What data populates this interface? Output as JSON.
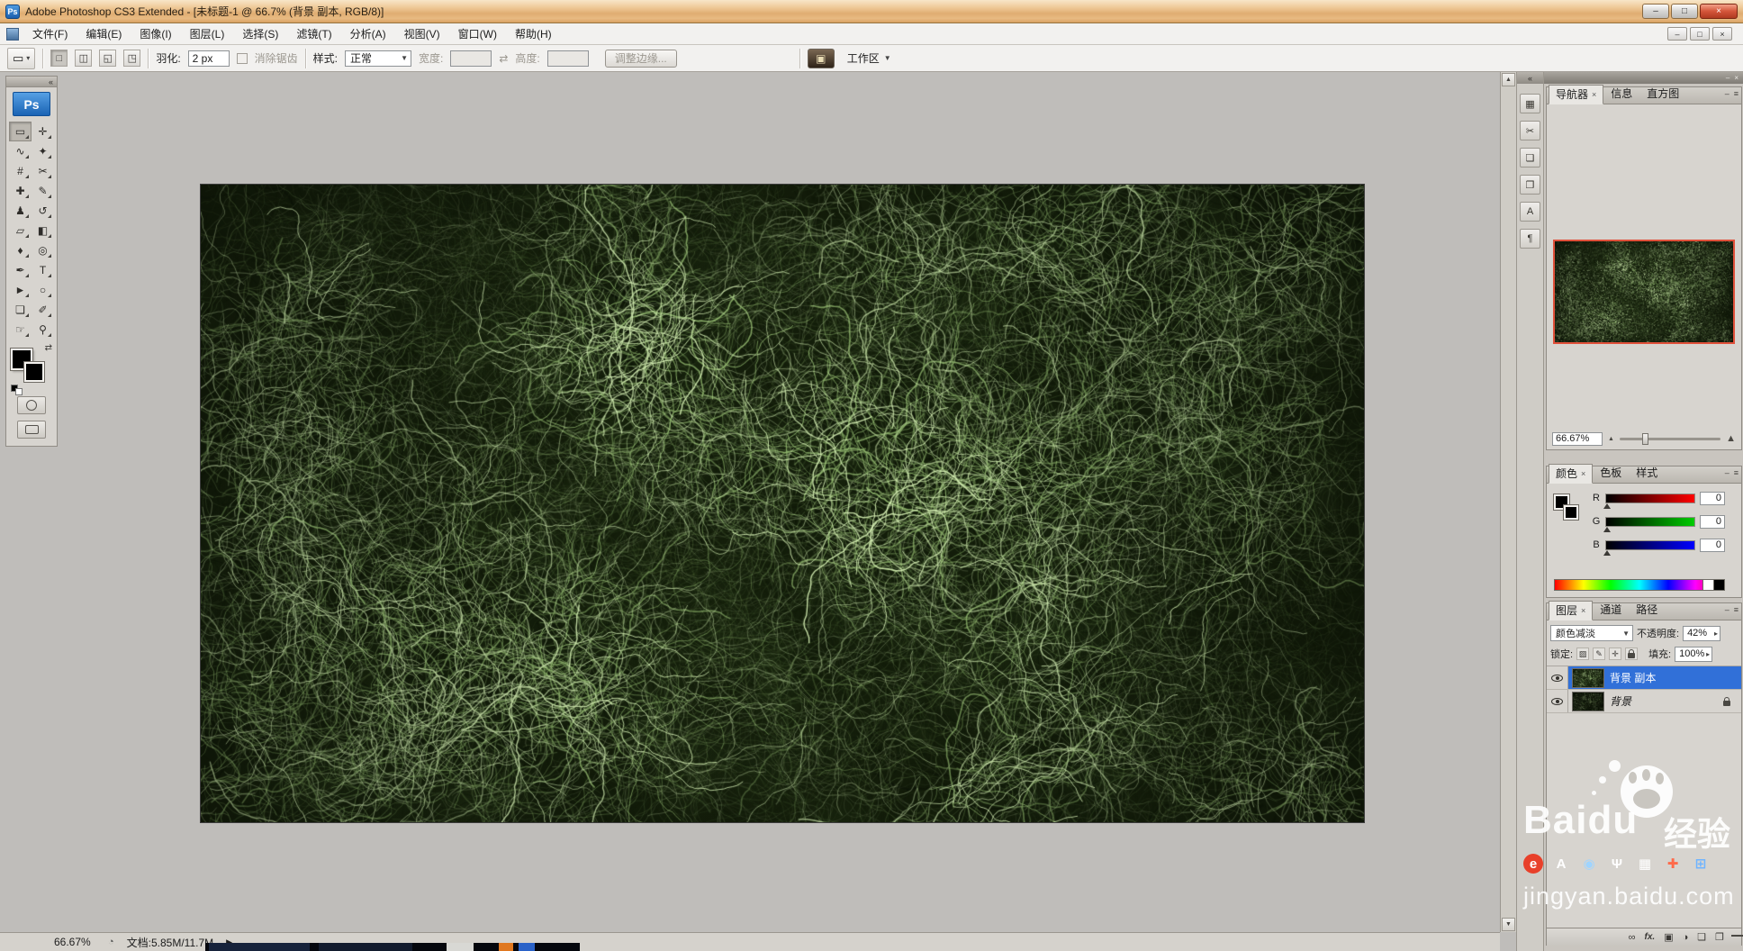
{
  "colors": {
    "titlebar_tan": "#e8ba82",
    "ps_logo_blue": "#2a78c8",
    "selected_layer_blue": "#3170d8",
    "proxy_view_border_red": "#e0503a",
    "close_button_red": "#d4553a",
    "texture_green_dark": "#131d0a",
    "texture_green_light": "#d6f0b4"
  },
  "glyphs": {
    "dropdown": "▾",
    "select_arrow": "▼",
    "up_arrow": "▲",
    "down_arrow": "▼",
    "flyout_arrow": "▶",
    "spin_arrow": "▸",
    "collapse_left": "«",
    "panel_menu": "≡",
    "panel_minimize": "–",
    "tab_close": "×",
    "swap_arrows": "⇄",
    "mountain_small": "▲",
    "mountain_large": "▲",
    "status_icon": "◔"
  },
  "window": {
    "app_icon": "Ps",
    "title": "Adobe Photoshop CS3 Extended - [未标题-1 @ 66.7% (背景 副本, RGB/8)]",
    "minimize": "–",
    "maximize": "□",
    "close": "×"
  },
  "menubar": {
    "items": [
      {
        "label": "文件(F)"
      },
      {
        "label": "编辑(E)"
      },
      {
        "label": "图像(I)"
      },
      {
        "label": "图层(L)"
      },
      {
        "label": "选择(S)"
      },
      {
        "label": "滤镜(T)"
      },
      {
        "label": "分析(A)"
      },
      {
        "label": "视图(V)"
      },
      {
        "label": "窗口(W)"
      },
      {
        "label": "帮助(H)"
      }
    ],
    "doc_minimize": "–",
    "doc_restore": "□",
    "doc_close": "×"
  },
  "options_bar": {
    "tool_glyph": "▭",
    "modes": [
      {
        "name": "new-selection",
        "glyph": "□"
      },
      {
        "name": "add-to-selection",
        "glyph": "◫"
      },
      {
        "name": "subtract-from-selection",
        "glyph": "◱"
      },
      {
        "name": "intersect-selection",
        "glyph": "◳"
      }
    ],
    "feather_label": "羽化:",
    "feather_value": "2 px",
    "antialias_label": "消除锯齿",
    "style_label": "样式:",
    "style_value": "正常",
    "width_label": "宽度:",
    "width_value": "",
    "height_label": "高度:",
    "height_value": "",
    "refine_edge_label": "调整边缘...",
    "bridge_glyph": "▣",
    "workspace_label": "工作区"
  },
  "toolbox": {
    "logo": "Ps",
    "tools": [
      {
        "name": "rectangular-marquee-tool",
        "glyph": "▭"
      },
      {
        "name": "move-tool",
        "glyph": "✛"
      },
      {
        "name": "lasso-tool",
        "glyph": "∿"
      },
      {
        "name": "quick-selection-tool",
        "glyph": "✦"
      },
      {
        "name": "crop-tool",
        "glyph": "#"
      },
      {
        "name": "slice-tool",
        "glyph": "✂"
      },
      {
        "name": "healing-brush-tool",
        "glyph": "✚"
      },
      {
        "name": "brush-tool",
        "glyph": "✎"
      },
      {
        "name": "clone-stamp-tool",
        "glyph": "♟"
      },
      {
        "name": "history-brush-tool",
        "glyph": "↺"
      },
      {
        "name": "eraser-tool",
        "glyph": "▱"
      },
      {
        "name": "gradient-tool",
        "glyph": "◧"
      },
      {
        "name": "blur-tool",
        "glyph": "♦"
      },
      {
        "name": "dodge-tool",
        "glyph": "◎"
      },
      {
        "name": "pen-tool",
        "glyph": "✒"
      },
      {
        "name": "type-tool",
        "glyph": "T"
      },
      {
        "name": "path-selection-tool",
        "glyph": "►"
      },
      {
        "name": "shape-tool",
        "glyph": "○"
      },
      {
        "name": "notes-tool",
        "glyph": "❏"
      },
      {
        "name": "eyedropper-tool",
        "glyph": "✐"
      },
      {
        "name": "hand-tool",
        "glyph": "☞"
      },
      {
        "name": "zoom-tool",
        "glyph": "⚲"
      }
    ]
  },
  "canvas": {
    "texture": {
      "base": "#131d0a",
      "dark": [
        8,
        14,
        5
      ],
      "fiber_mid": [
        148,
        186,
        112
      ],
      "fiber_light": [
        214,
        240,
        180
      ]
    }
  },
  "panels": {
    "dock_icons": [
      {
        "name": "panels-icon",
        "glyph": "▦"
      },
      {
        "name": "scissors-icon",
        "glyph": "✂"
      },
      {
        "name": "pages-icon",
        "glyph": "❏"
      },
      {
        "name": "copy-icon",
        "glyph": "❐"
      },
      {
        "name": "character-icon",
        "glyph": "A"
      },
      {
        "name": "paragraph-icon",
        "glyph": "¶"
      }
    ],
    "navigator": {
      "tabs": [
        "导航器",
        "信息",
        "直方图"
      ],
      "zoom_value": "66.67%"
    },
    "color": {
      "tabs": [
        "颜色",
        "色板",
        "样式"
      ],
      "channels": [
        {
          "label": "R",
          "value": "0"
        },
        {
          "label": "G",
          "value": "0"
        },
        {
          "label": "B",
          "value": "0"
        }
      ]
    },
    "layers": {
      "tabs": [
        "图层",
        "通道",
        "路径"
      ],
      "blend_mode": "颜色减淡",
      "opacity_label": "不透明度:",
      "opacity_value": "42%",
      "lock_label": "锁定:",
      "lock_icons": [
        {
          "name": "lock-transparency-icon",
          "glyph": "▨"
        },
        {
          "name": "lock-paint-icon",
          "glyph": "✎"
        },
        {
          "name": "lock-move-icon",
          "glyph": "✛"
        }
      ],
      "fill_label": "填充:",
      "fill_value": "100%",
      "items": [
        {
          "name": "背景 副本",
          "selected": true
        },
        {
          "name": "背景",
          "locked": true
        }
      ],
      "buttons": [
        {
          "name": "link-layers-icon",
          "glyph": "∞"
        },
        {
          "name": "layer-style-icon",
          "glyph": "fx."
        },
        {
          "name": "layer-mask-icon",
          "glyph": "▣"
        },
        {
          "name": "adjustment-layer-icon",
          "glyph": "◑"
        },
        {
          "name": "layer-group-icon",
          "glyph": "❏"
        },
        {
          "name": "new-layer-icon",
          "glyph": "❐"
        }
      ]
    }
  },
  "status_bar": {
    "zoom": "66.67%",
    "doc_info": "文档:5.85M/11.7M"
  },
  "watermark": {
    "brand": "Baidu",
    "suffix": "经验",
    "url": "jingyan.baidu.com",
    "icons": [
      {
        "name": "flame-icon",
        "glyph": "e",
        "color": "#ffffff"
      },
      {
        "name": "letter-a-icon",
        "glyph": "A",
        "color": "#ffffff"
      },
      {
        "name": "circle-icon",
        "glyph": "◉",
        "color": "#9fd4ff"
      },
      {
        "name": "mic-icon",
        "glyph": "Ψ",
        "color": "#ffffff"
      },
      {
        "name": "keyboard-icon",
        "glyph": "▦",
        "color": "#ffffff"
      },
      {
        "name": "plus-icon",
        "glyph": "✚",
        "color": "#ff6a4a"
      },
      {
        "name": "grid-icon",
        "glyph": "⊞",
        "color": "#6fb4ff"
      }
    ]
  }
}
